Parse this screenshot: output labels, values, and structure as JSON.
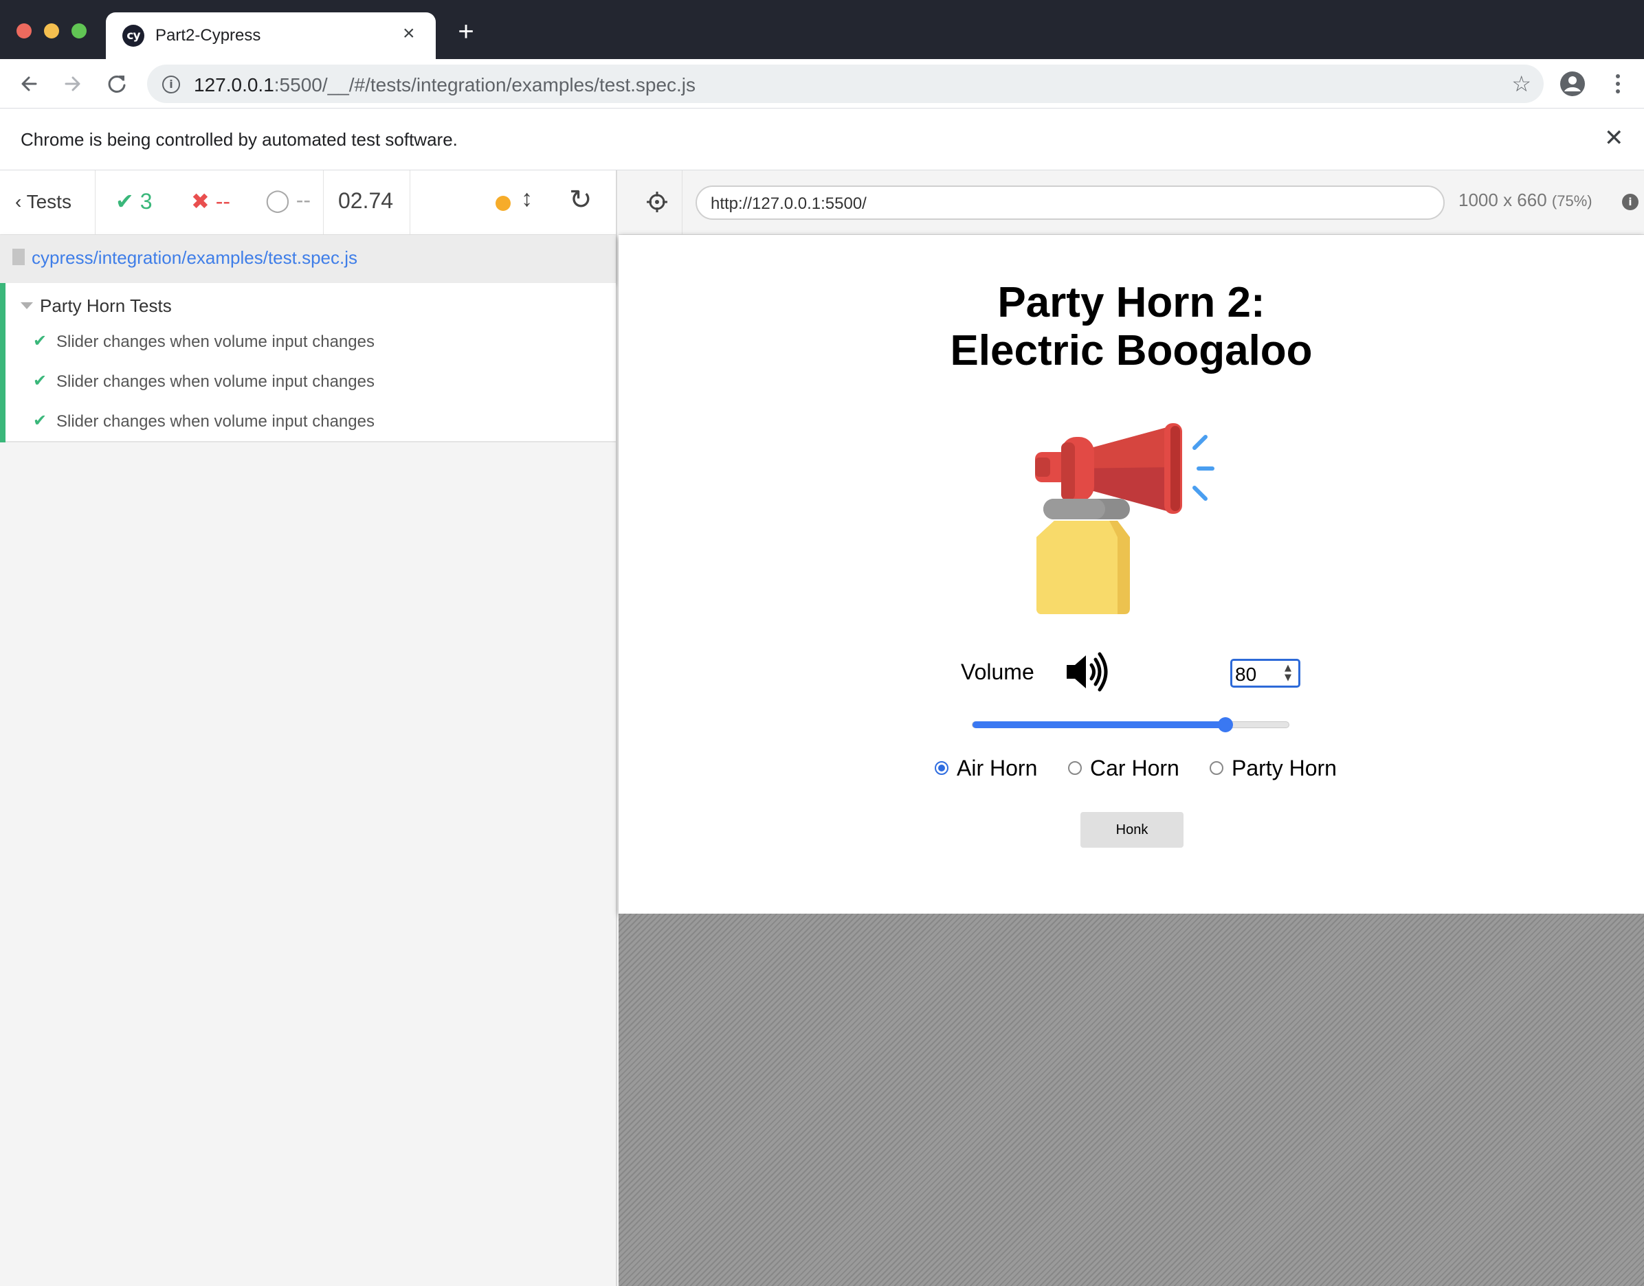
{
  "browser": {
    "tab_title": "Part2-Cypress",
    "tab_favicon": "cy",
    "url_host": "127.0.0.1",
    "url_rest": ":5500/__/#/tests/integration/examples/test.spec.js",
    "infobar_text": "Chrome is being controlled by automated test software."
  },
  "runner": {
    "back_label": "Tests",
    "passed": "3",
    "failed": "--",
    "pending": "--",
    "duration": "02.74",
    "spec_path": "cypress/integration/examples/test.spec.js",
    "suite_title": "Party Horn Tests",
    "tests": [
      {
        "title": "Slider changes when volume input changes"
      },
      {
        "title": "Slider changes when volume input changes"
      },
      {
        "title": "Slider changes when volume input changes"
      }
    ]
  },
  "aut": {
    "url": "http://127.0.0.1:5500/",
    "viewport_size": "1000 x 660",
    "viewport_scale": "(75%)"
  },
  "page": {
    "title_line1": "Party Horn 2:",
    "title_line2": "Electric Boogaloo",
    "volume_label": "Volume",
    "volume_value": "80",
    "slider_value": 80,
    "slider_max": 100,
    "radios": [
      {
        "label": "Air Horn",
        "checked": true
      },
      {
        "label": "Car Horn",
        "checked": false
      },
      {
        "label": "Party Horn",
        "checked": false
      }
    ],
    "honk_label": "Honk"
  },
  "colors": {
    "accent_blue": "#3a78f2",
    "pass_green": "#3ab77a",
    "fail_red": "#e94f4f",
    "link_blue": "#3f7ee8",
    "status_dot": "#f6ac2a"
  },
  "icons": {
    "tab_close": "close-icon",
    "new_tab": "plus-icon",
    "back": "arrow-left-icon",
    "forward": "arrow-right-icon",
    "reload": "reload-icon",
    "site_info": "info-icon",
    "bookmark": "star-icon",
    "profile": "account-icon",
    "menu": "kebab-menu-icon",
    "selector_playground": "crosshair-icon",
    "volume": "speaker-icon",
    "horn_image": "air-horn-icon"
  }
}
